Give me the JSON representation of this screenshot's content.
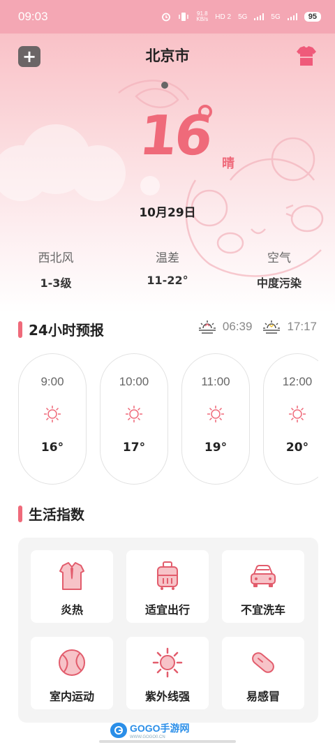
{
  "status_bar": {
    "time": "09:03",
    "speed": "91.8\nKB/s",
    "network1": "HD 2",
    "network2": "5G",
    "network3": "5G",
    "battery": "95"
  },
  "header": {
    "city": "北京市",
    "add_label": "+"
  },
  "current": {
    "temperature": "16",
    "condition": "晴",
    "date": "10月29日"
  },
  "stats": [
    {
      "label": "西北风",
      "value": "1-3级"
    },
    {
      "label": "温差",
      "value": "11-22°"
    },
    {
      "label": "空气",
      "value": "中度污染"
    }
  ],
  "forecast": {
    "title": "24小时预报",
    "sunrise": "06:39",
    "sunset": "17:17",
    "hours": [
      {
        "time": "9:00",
        "temp": "16°",
        "icon": "sun-icon"
      },
      {
        "time": "10:00",
        "temp": "17°",
        "icon": "sun-icon"
      },
      {
        "time": "11:00",
        "temp": "19°",
        "icon": "sun-icon"
      },
      {
        "time": "12:00",
        "temp": "20°",
        "icon": "sun-icon"
      }
    ]
  },
  "life": {
    "title": "生活指数",
    "items": [
      {
        "label": "炎热",
        "icon": "shirt-icon"
      },
      {
        "label": "适宜出行",
        "icon": "luggage-icon"
      },
      {
        "label": "不宜洗车",
        "icon": "car-icon"
      },
      {
        "label": "室内运动",
        "icon": "ball-icon"
      },
      {
        "label": "紫外线强",
        "icon": "uv-sun-icon"
      },
      {
        "label": "易感冒",
        "icon": "pill-icon"
      }
    ]
  },
  "watermark": {
    "text": "GOGO手游网",
    "sub": "WWW.GOGO0.CN"
  },
  "colors": {
    "accent": "#ef6a7a",
    "status_bar": "#f4a7b4",
    "hero_top": "#f9c1c7"
  }
}
